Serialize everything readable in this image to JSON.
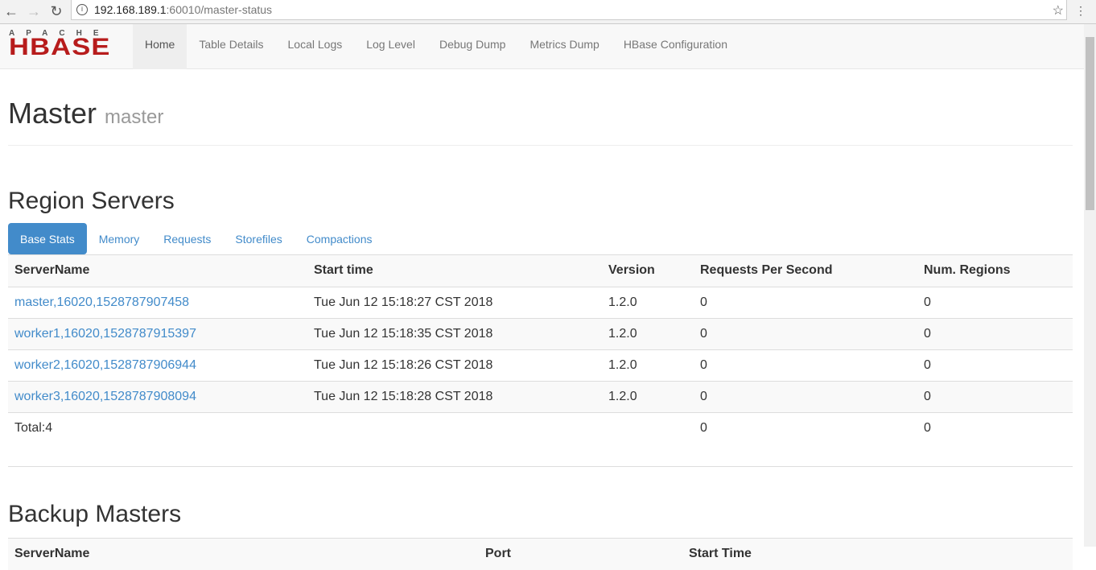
{
  "browser": {
    "url_host": "192.168.189.1",
    "url_rest": ":60010/master-status"
  },
  "nav": {
    "logo_top": "APACHE",
    "logo_main": "HBASE",
    "items": [
      "Home",
      "Table Details",
      "Local Logs",
      "Log Level",
      "Debug Dump",
      "Metrics Dump",
      "HBase Configuration"
    ]
  },
  "header": {
    "title": "Master",
    "subtitle": "master"
  },
  "region_servers": {
    "title": "Region Servers",
    "tabs": [
      "Base Stats",
      "Memory",
      "Requests",
      "Storefiles",
      "Compactions"
    ],
    "columns": [
      "ServerName",
      "Start time",
      "Version",
      "Requests Per Second",
      "Num. Regions"
    ],
    "rows": [
      [
        "master,16020,1528787907458",
        "Tue Jun 12 15:18:27 CST 2018",
        "1.2.0",
        "0",
        "0"
      ],
      [
        "worker1,16020,1528787915397",
        "Tue Jun 12 15:18:35 CST 2018",
        "1.2.0",
        "0",
        "0"
      ],
      [
        "worker2,16020,1528787906944",
        "Tue Jun 12 15:18:26 CST 2018",
        "1.2.0",
        "0",
        "0"
      ],
      [
        "worker3,16020,1528787908094",
        "Tue Jun 12 15:18:28 CST 2018",
        "1.2.0",
        "0",
        "0"
      ]
    ],
    "total": {
      "label": "Total:4",
      "requests": "0",
      "regions": "0"
    }
  },
  "backup_masters": {
    "title": "Backup Masters",
    "columns": [
      "ServerName",
      "Port",
      "Start Time"
    ]
  }
}
